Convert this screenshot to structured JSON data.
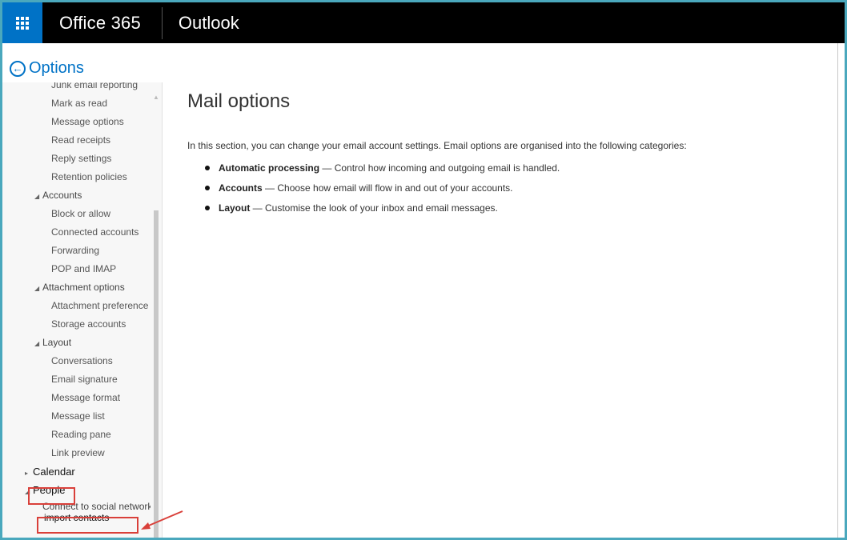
{
  "topbar": {
    "waffle_icon": "app-launcher-icon",
    "brand": "Office 365",
    "app_name": "Outlook"
  },
  "options": {
    "back_icon": "back-arrow-circle-icon",
    "label": "Options"
  },
  "nav": {
    "items": [
      {
        "label": "Junk email reporting",
        "level": 2
      },
      {
        "label": "Mark as read",
        "level": 2
      },
      {
        "label": "Message options",
        "level": 2
      },
      {
        "label": "Read receipts",
        "level": 2
      },
      {
        "label": "Reply settings",
        "level": 2
      },
      {
        "label": "Retention policies",
        "level": 2
      },
      {
        "label": "Accounts",
        "level": 1,
        "expanded": true
      },
      {
        "label": "Block or allow",
        "level": 2
      },
      {
        "label": "Connected accounts",
        "level": 2
      },
      {
        "label": "Forwarding",
        "level": 2
      },
      {
        "label": "POP and IMAP",
        "level": 2
      },
      {
        "label": "Attachment options",
        "level": 1,
        "expanded": true
      },
      {
        "label": "Attachment preference",
        "level": 2
      },
      {
        "label": "Storage accounts",
        "level": 2
      },
      {
        "label": "Layout",
        "level": 1,
        "expanded": true
      },
      {
        "label": "Conversations",
        "level": 2
      },
      {
        "label": "Email signature",
        "level": 2
      },
      {
        "label": "Message format",
        "level": 2
      },
      {
        "label": "Message list",
        "level": 2
      },
      {
        "label": "Reading pane",
        "level": 2
      },
      {
        "label": "Link preview",
        "level": 2
      },
      {
        "label": "Calendar",
        "level": 0,
        "expanded": false
      },
      {
        "label": "People",
        "level": 0,
        "expanded": true
      },
      {
        "label": "Connect to social networks",
        "level": 1
      },
      {
        "label": "import contacts",
        "level": 1
      }
    ]
  },
  "main": {
    "title": "Mail options",
    "intro": "In this section, you can change your email account settings. Email options are organised into the following categories:",
    "bullets": [
      {
        "term": "Automatic processing",
        "desc": " — Control how incoming and outgoing email is handled."
      },
      {
        "term": "Accounts",
        "desc": " — Choose how email will flow in and out of your accounts."
      },
      {
        "term": "Layout",
        "desc": " — Customise the look of your inbox and email messages."
      }
    ]
  },
  "annotations": {
    "highlight_color": "#d9403a",
    "highlighted": [
      "People",
      "import contacts"
    ]
  }
}
